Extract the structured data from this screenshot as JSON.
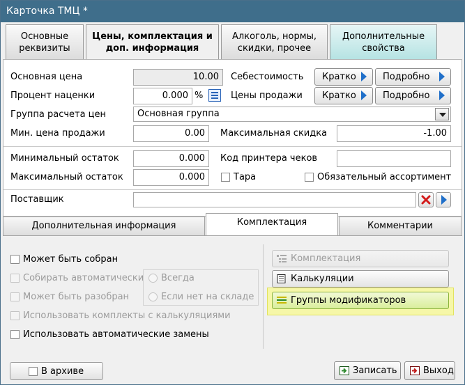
{
  "window": {
    "title": "Карточка ТМЦ *"
  },
  "top_tabs": [
    {
      "label": "Основные\nреквизиты"
    },
    {
      "label": "Цены, комплектация и\nдоп. информация"
    },
    {
      "label": "Алкоголь, нормы,\nскидки, прочее"
    },
    {
      "label": "Дополнительные\nсвойства"
    }
  ],
  "prices": {
    "base_price_label": "Основная цена",
    "base_price_value": "10.00",
    "markup_label": "Процент наценки",
    "markup_value": "0.000",
    "markup_unit": "%",
    "price_group_label": "Группа расчета цен",
    "price_group_value": "Основная группа",
    "min_price_label": "Мин. цена продажи",
    "min_price_value": "0.00",
    "cost_label": "Себестоимость",
    "sales_prices_label": "Цены продажи",
    "short_button": "Кратко",
    "detail_button": "Подробно",
    "max_discount_label": "Максимальная скидка",
    "max_discount_value": "-1.00"
  },
  "stock": {
    "min_stock_label": "Минимальный остаток",
    "min_stock_value": "0.000",
    "max_stock_label": "Максимальный остаток",
    "max_stock_value": "0.000",
    "printer_code_label": "Код принтера чеков",
    "printer_code_value": "",
    "tara_label": "Тара",
    "required_assortment_label": "Обязательный ассортимент"
  },
  "supplier": {
    "label": "Поставщик",
    "value": ""
  },
  "sub_tabs": [
    {
      "label": "Дополнительная информация"
    },
    {
      "label": "Комплектация"
    },
    {
      "label": "Комментарии"
    }
  ],
  "kit": {
    "can_be_assembled": "Может быть собран",
    "assemble_auto": "Собирать автоматически",
    "always": "Всегда",
    "if_not_in_stock": "Если нет на складе",
    "can_be_disassembled": "Может быть разобран",
    "use_kits_with_calc": "Использовать комплекты с калькуляциями",
    "use_auto_replace": "Использовать автоматические замены",
    "btn_kit": "Комплектация",
    "btn_calc": "Калькуляции",
    "btn_modifier_groups": "Группы модификаторов"
  },
  "footer": {
    "archive_label": "В архиве",
    "save_button": "Записать",
    "exit_button": "Выход"
  }
}
